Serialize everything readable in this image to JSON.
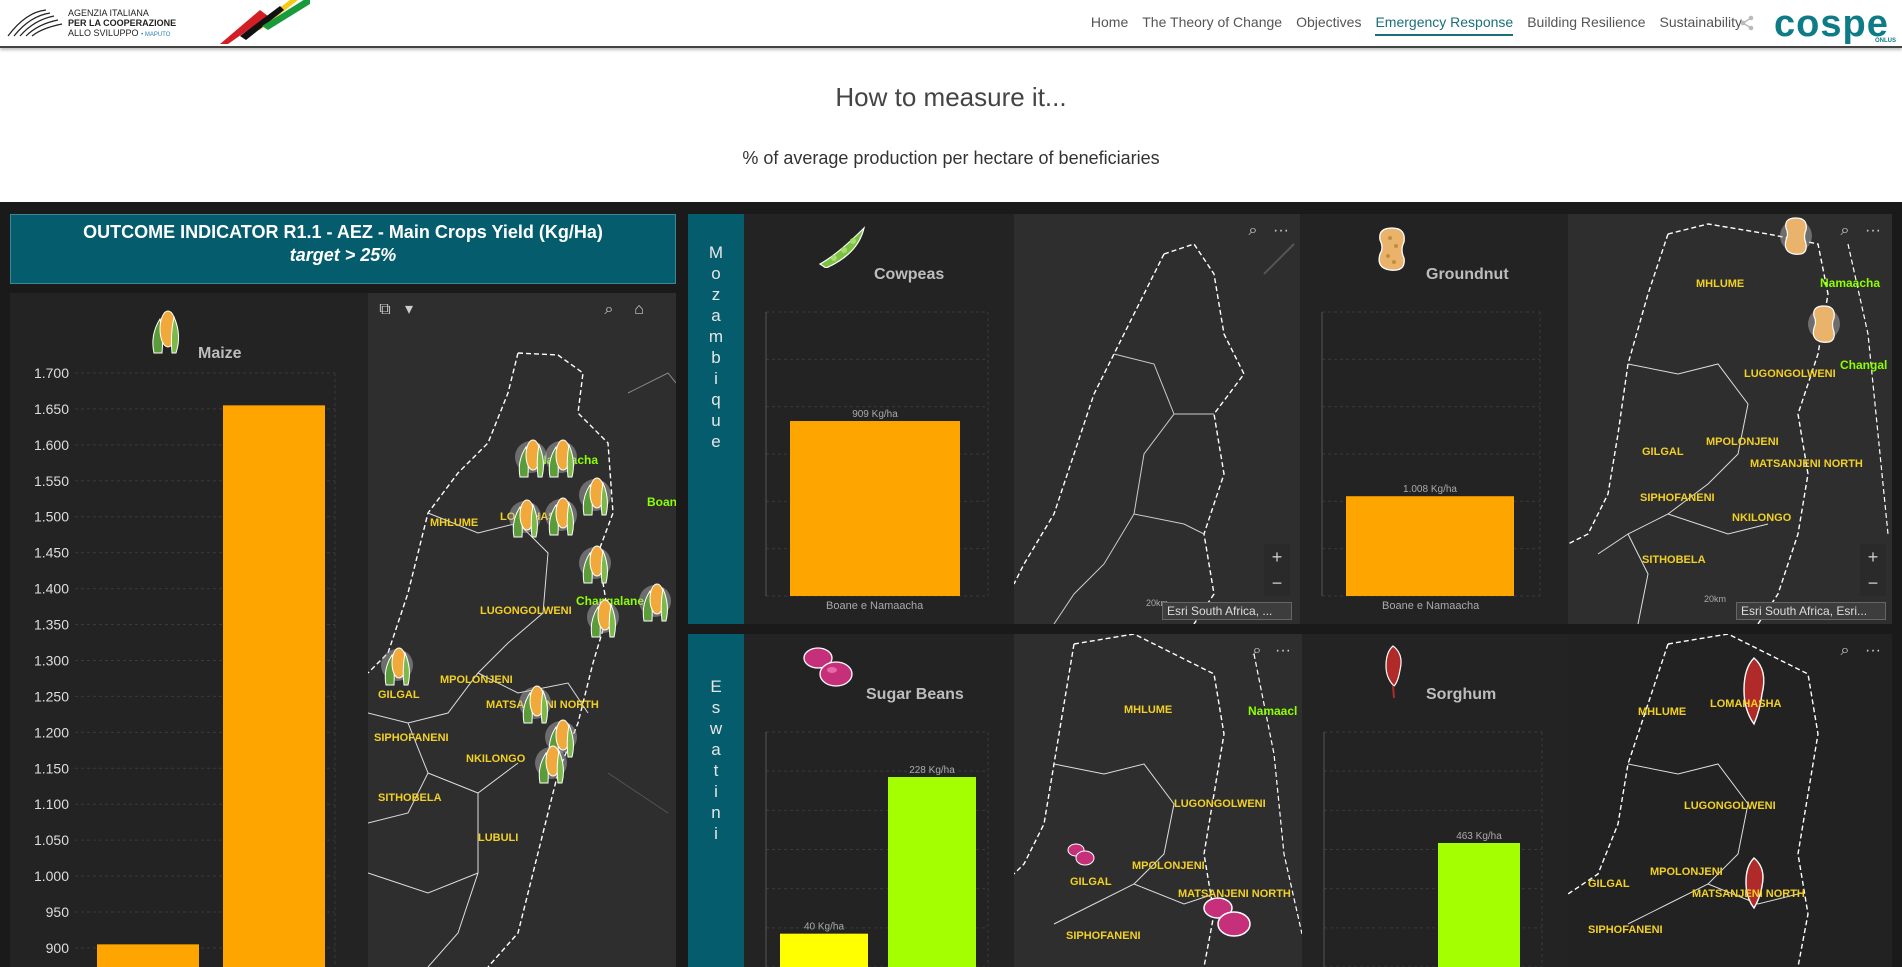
{
  "header": {
    "aics_line1": "AGENZIA ITALIANA",
    "aics_line2": "PER LA COOPERAZIONE",
    "aics_line3": "ALLO SVILUPPO",
    "aics_city": "• MAPUTO",
    "nav": [
      "Home",
      "The Theory of Change",
      "Objectives",
      "Emergency Response",
      "Building Resilience",
      "Sustainability"
    ],
    "active_nav": "Emergency Response",
    "cospe_word": "cospe",
    "cospe_small": "ONLUS"
  },
  "page": {
    "title": "How to measure it...",
    "subtitle": "% of average production per hectare of beneficiaries"
  },
  "indicator": {
    "line1": "OUTCOME INDICATOR R1.1 - AEZ - Main Crops Yield (Kg/Ha)",
    "line2": "target > 25%"
  },
  "side_tabs": {
    "mozambique": "Mozambique",
    "eswatini": "Eswatini"
  },
  "colors": {
    "teal": "#055c6c",
    "orange": "#ffa500",
    "lime": "#a4ff00",
    "yellow": "#ffff00",
    "map_label": "#f2d024",
    "map_green": "#8cff00"
  },
  "chart_data": [
    {
      "type": "bar",
      "title": "Maize",
      "ylim": [
        900,
        1700
      ],
      "yticks": [
        "1.700",
        "1.650",
        "1.600",
        "1.550",
        "1.500",
        "1.450",
        "1.400",
        "1.350",
        "1.300",
        "1.250",
        "1.200",
        "1.150",
        "1.100",
        "1.050",
        "1.000",
        "950",
        "900"
      ],
      "values": [
        905,
        1655
      ],
      "bar_colors": [
        "#ffa500",
        "#ffa500"
      ]
    },
    {
      "type": "bar",
      "title": "Cowpeas",
      "categories": [
        "Boane e Namaacha"
      ],
      "values": [
        909
      ],
      "value_labels": [
        "909 Kg/ha"
      ],
      "bar_colors": [
        "#ffa500"
      ]
    },
    {
      "type": "bar",
      "title": "Groundnut",
      "categories": [
        "Boane e Namaacha"
      ],
      "values": [
        1008
      ],
      "value_labels": [
        "1.008 Kg/ha"
      ],
      "bar_colors": [
        "#ffa500"
      ]
    },
    {
      "type": "bar",
      "title": "Sugar Beans",
      "values": [
        40,
        228
      ],
      "value_labels": [
        "40 Kg/ha",
        "228 Kg/ha"
      ],
      "bar_colors": [
        "#ffff00",
        "#a4ff00"
      ]
    },
    {
      "type": "bar",
      "title": "Sorghum",
      "values": [
        463
      ],
      "value_labels": [
        "463 Kg/ha"
      ],
      "bar_colors": [
        "#a4ff00"
      ]
    }
  ],
  "maps": {
    "maize_map": [
      "Namaacha",
      "Boan",
      "MHLUME",
      "LOMAHASHA",
      "Changalane",
      "LUGONGOLWENI",
      "GILGAL",
      "MPOLONJENI",
      "MATSANJENI NORTH",
      "SIPHOFANENI",
      "NKILONGO",
      "SITHOBELA",
      "LUBULI"
    ],
    "cowpeas_map": [
      "20km",
      "Esri South Africa, ..."
    ],
    "groundnut_map": [
      "MHLUME",
      "Namaacha",
      "Changal",
      "LUGONGOLWENI",
      "MPOLONJENI",
      "GILGAL",
      "MATSANJENI NORTH",
      "SIPHOFANENI",
      "NKILONGO",
      "SITHOBELA",
      "20km",
      "Esri South Africa, Esri..."
    ],
    "sugarbeans_map": [
      "MHLUME",
      "Namaacl",
      "LUGONGOLWENI",
      "GILGAL",
      "MPOLONJENI",
      "MATSANJENI NORTH",
      "SIPHOFANENI"
    ],
    "sorghum_map": [
      "MHLUME",
      "LOMAHASHA",
      "LUGONGOLWENI",
      "GILGAL",
      "MPOLONJENI",
      "MATSANJENI NORTH",
      "SIPHOFANENI"
    ]
  },
  "tools": {
    "more": "···",
    "plus": "+",
    "minus": "−"
  }
}
